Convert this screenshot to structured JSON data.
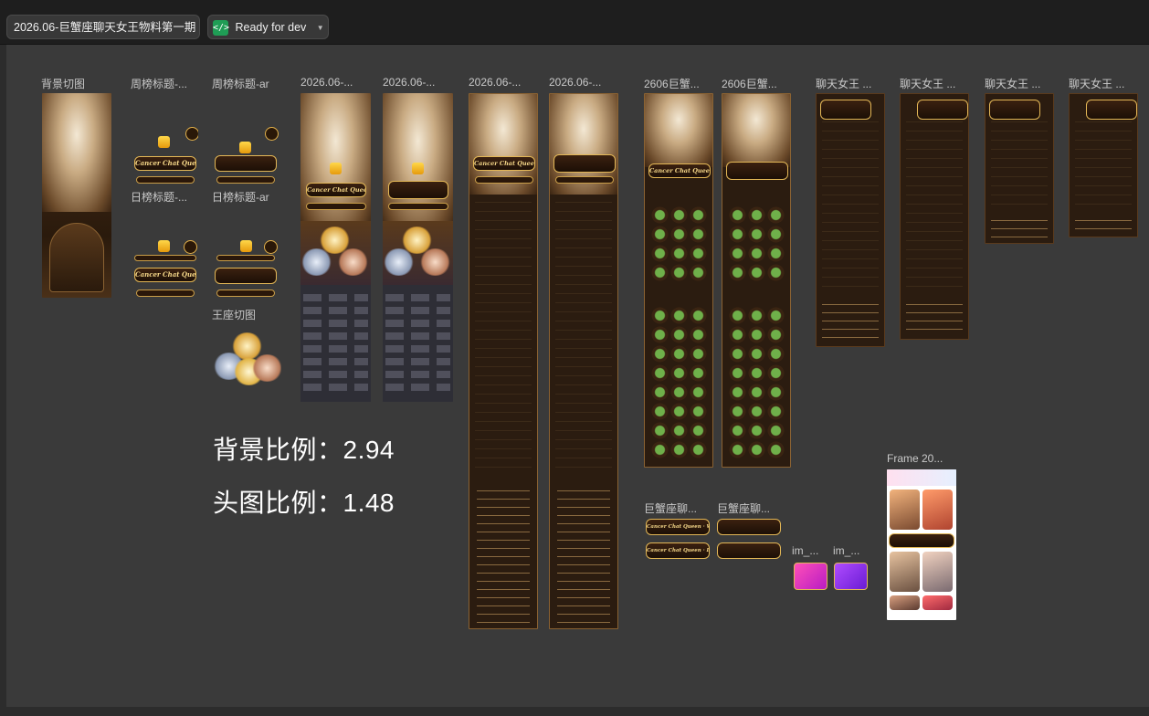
{
  "toolbar": {
    "file_name": "2026.06-巨蟹座聊天女王物料第一期",
    "status_label": "Ready for dev",
    "status_icon": "code-icon",
    "status_color": "#1f9d55"
  },
  "canvas": {
    "background": "#3a3a3a",
    "frames": [
      {
        "label": "背景切图"
      },
      {
        "label": "周榜标题-..."
      },
      {
        "label": "周榜标题-ar"
      },
      {
        "label": "日榜标题-..."
      },
      {
        "label": "日榜标题-ar"
      },
      {
        "label": "王座切图"
      },
      {
        "label": "2026.06-..."
      },
      {
        "label": "2026.06-..."
      },
      {
        "label": "2026.06-..."
      },
      {
        "label": "2026.06-..."
      },
      {
        "label": "2606巨蟹..."
      },
      {
        "label": "2606巨蟹..."
      },
      {
        "label": "聊天女王 ..."
      },
      {
        "label": "聊天女王 ..."
      },
      {
        "label": "聊天女王 ..."
      },
      {
        "label": "聊天女王 ..."
      },
      {
        "label": "巨蟹座聊..."
      },
      {
        "label": "巨蟹座聊..."
      },
      {
        "label": "im_..."
      },
      {
        "label": "im_..."
      },
      {
        "label": "Frame 20..."
      }
    ],
    "notes": {
      "bg_ratio": "背景比例：2.94",
      "header_ratio": "头图比例：1.48"
    },
    "banner_texts": {
      "cancer_chat_queen": "Cancer Chat Queen",
      "cancer_weekly": "Cancer Chat Queen · Weekly",
      "cancer_daily": "Cancer Chat Queen · Daily"
    }
  }
}
